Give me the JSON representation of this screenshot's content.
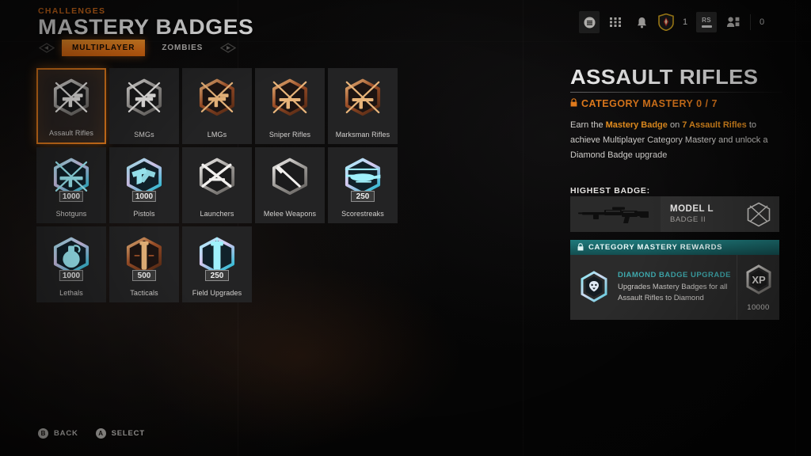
{
  "header": {
    "kicker": "CHALLENGES",
    "title": "MASTERY BADGES"
  },
  "tabs": {
    "left_arrow_icon": "arrow-left-icon",
    "right_arrow_icon": "arrow-right-icon",
    "items": [
      {
        "label": "MULTIPLAYER",
        "active": true
      },
      {
        "label": "ZOMBIES",
        "active": false
      }
    ]
  },
  "hud": {
    "menu_icon": "menu-button-icon",
    "apps_icon": "apps-grid-icon",
    "bell_icon": "notification-bell-icon",
    "clan_icon": "clan-emblem-icon",
    "clan_count": "1",
    "rs_key_label": "RS",
    "friends_icon": "friends-icon",
    "friends_count": "0"
  },
  "grid": {
    "rows": [
      [
        {
          "label": "Assault Rifles",
          "count": "",
          "tier": "silver",
          "art": "crossed-rifles-icon",
          "selected": true
        },
        {
          "label": "SMGs",
          "count": "",
          "tier": "silver",
          "art": "crossed-smg-icon",
          "selected": false
        },
        {
          "label": "LMGs",
          "count": "",
          "tier": "bronze",
          "art": "crossed-lmg-icon",
          "selected": false
        },
        {
          "label": "Sniper Rifles",
          "count": "",
          "tier": "bronze",
          "art": "crossed-sniper-icon",
          "selected": false
        },
        {
          "label": "Marksman Rifles",
          "count": "",
          "tier": "bronze",
          "art": "crossed-marksman-icon",
          "selected": false
        }
      ],
      [
        {
          "label": "Shotguns",
          "count": "1000",
          "tier": "diamond",
          "art": "crossed-shotgun-icon",
          "selected": false
        },
        {
          "label": "Pistols",
          "count": "1000",
          "tier": "diamond",
          "art": "crossed-pistol-icon",
          "selected": false
        },
        {
          "label": "Launchers",
          "count": "",
          "tier": "silver",
          "art": "crossed-launcher-icon",
          "selected": false
        },
        {
          "label": "Melee Weapons",
          "count": "",
          "tier": "silver",
          "art": "crossed-knife-icon",
          "selected": false
        },
        {
          "label": "Scorestreaks",
          "count": "250",
          "tier": "diamond",
          "art": "helicopter-icon",
          "selected": false
        }
      ],
      [
        {
          "label": "Lethals",
          "count": "1000",
          "tier": "diamond",
          "art": "grenade-icon",
          "selected": false
        },
        {
          "label": "Tacticals",
          "count": "500",
          "tier": "bronze",
          "art": "tactical-icon",
          "selected": false
        },
        {
          "label": "Field Upgrades",
          "count": "250",
          "tier": "diamond",
          "art": "field-upgrade-icon",
          "selected": false
        }
      ]
    ]
  },
  "panel": {
    "title": "ASSAULT RIFLES",
    "lock_icon": "lock-icon",
    "mastery_label": "CATEGORY MASTERY 0 / 7",
    "description": {
      "part1": "Earn the ",
      "highlight1": "Mastery Badge",
      "part2": " on ",
      "highlight2": "7 Assault Rifles",
      "part3": " to achieve Multiplayer Category Mastery and unlock a Diamond Badge upgrade"
    },
    "highest_badge": {
      "heading": "HIGHEST BADGE:",
      "weapon_icon": "assault-rifle-silhouette-icon",
      "name": "MODEL L",
      "sub": "BADGE II",
      "badge_icon": "crossed-rifles-badge-icon"
    },
    "rewards": {
      "bar_lock_icon": "lock-icon",
      "bar_label": "CATEGORY MASTERY REWARDS",
      "item": {
        "icon": "diamond-badge-icon",
        "title": "DIAMOND BADGE UPGRADE",
        "desc": "Upgrades Mastery Badges for all Assault Rifles to Diamond",
        "xp_icon": "xp-hex-icon",
        "xp_amount": "10000"
      }
    }
  },
  "footer": {
    "buttons": [
      {
        "key": "B",
        "label": "BACK"
      },
      {
        "key": "A",
        "label": "SELECT"
      }
    ]
  },
  "colors": {
    "accent_orange": "#e07a1c",
    "accent_teal": "#1f7a7c",
    "teal_text": "#3fa9ad",
    "card_bg": "#232324",
    "page_bg": "#050505"
  }
}
